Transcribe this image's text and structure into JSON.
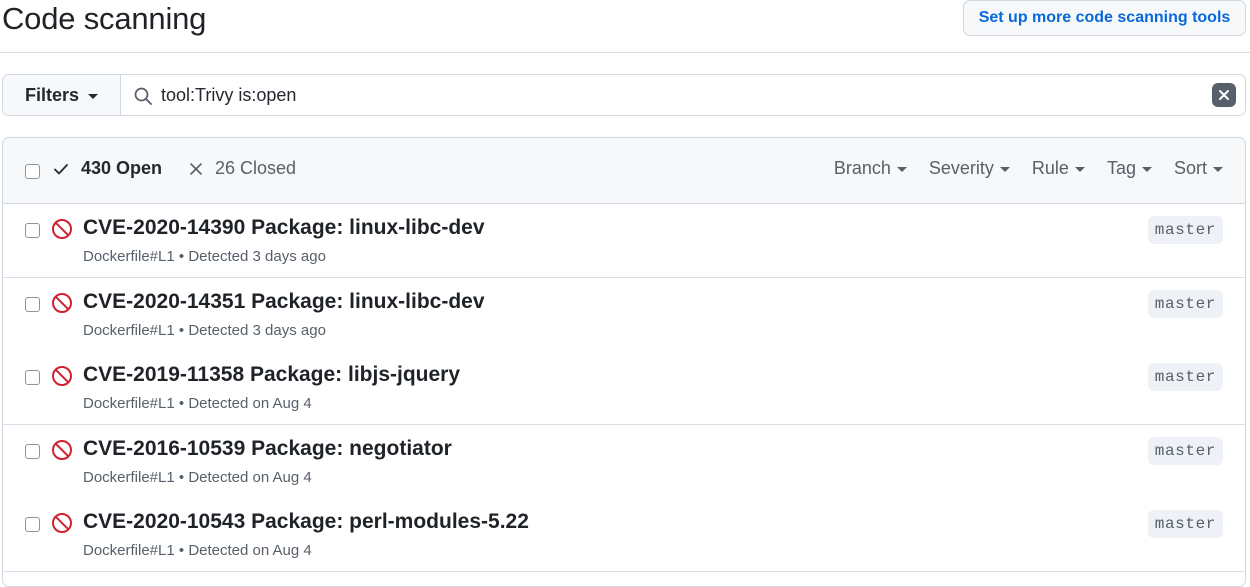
{
  "header": {
    "title": "Code scanning",
    "setup_button_label": "Set up more code scanning tools"
  },
  "filter_bar": {
    "filters_label": "Filters",
    "search_value": "tool:Trivy is:open",
    "icons": {
      "search": "search-icon",
      "clear": "clear-icon"
    }
  },
  "alerts_header": {
    "open_label": "430 Open",
    "closed_label": "26 Closed",
    "menus": [
      {
        "label": "Branch"
      },
      {
        "label": "Severity"
      },
      {
        "label": "Rule"
      },
      {
        "label": "Tag"
      },
      {
        "label": "Sort"
      }
    ]
  },
  "alerts": [
    {
      "title": "CVE-2020-14390 Package: linux-libc-dev",
      "location": "Dockerfile#L1",
      "detected": "Detected 3 days ago",
      "branch": "master"
    },
    {
      "title": "CVE-2020-14351 Package: linux-libc-dev",
      "location": "Dockerfile#L1",
      "detected": "Detected 3 days ago",
      "branch": "master"
    },
    {
      "title": "CVE-2019-11358 Package: libjs-jquery",
      "location": "Dockerfile#L1",
      "detected": "Detected on Aug 4",
      "branch": "master"
    },
    {
      "title": "CVE-2016-10539 Package: negotiator",
      "location": "Dockerfile#L1",
      "detected": "Detected on Aug 4",
      "branch": "master"
    },
    {
      "title": "CVE-2020-10543 Package: perl-modules-5.22",
      "location": "Dockerfile#L1",
      "detected": "Detected on Aug 4",
      "branch": "master"
    }
  ],
  "meta_separator": "•",
  "colors": {
    "link": "#0969da",
    "alert_icon": "#cf222e",
    "muted_text": "#57606a",
    "border": "#d0d7de"
  }
}
